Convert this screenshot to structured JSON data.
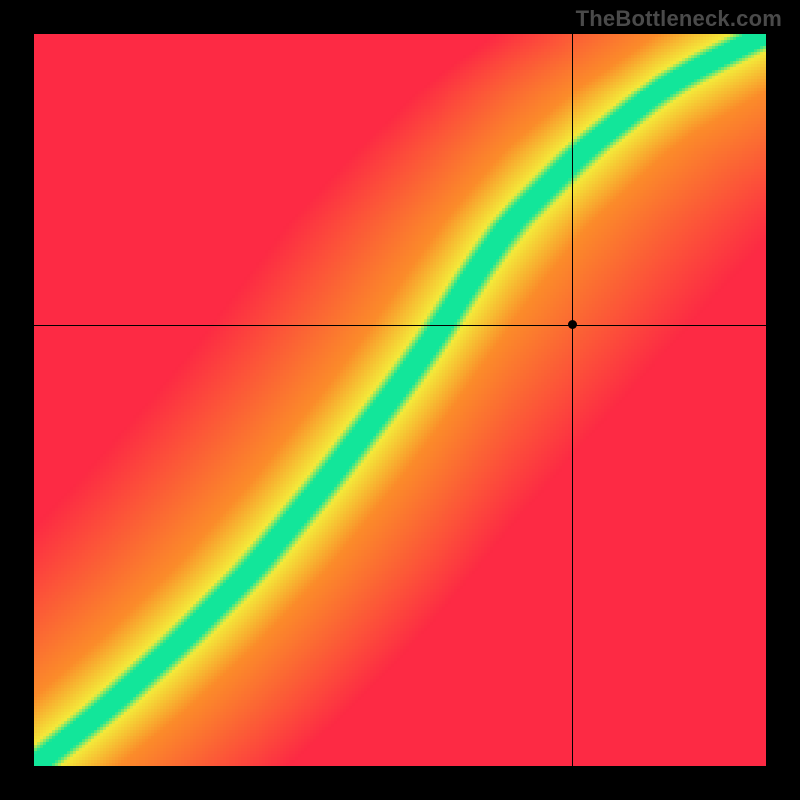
{
  "watermark": "TheBottleneck.com",
  "chart_data": {
    "type": "heatmap",
    "title": "",
    "xlabel": "",
    "ylabel": "",
    "xlim": [
      0,
      1
    ],
    "ylim": [
      0,
      1
    ],
    "crosshair": {
      "x": 0.735,
      "y": 0.603
    },
    "marker": {
      "x": 0.735,
      "y": 0.603
    },
    "ridge_path": [
      {
        "x": 0.0,
        "y": 0.0
      },
      {
        "x": 0.1,
        "y": 0.08
      },
      {
        "x": 0.2,
        "y": 0.17
      },
      {
        "x": 0.3,
        "y": 0.27
      },
      {
        "x": 0.4,
        "y": 0.39
      },
      {
        "x": 0.5,
        "y": 0.52
      },
      {
        "x": 0.55,
        "y": 0.59
      },
      {
        "x": 0.6,
        "y": 0.67
      },
      {
        "x": 0.65,
        "y": 0.74
      },
      {
        "x": 0.7,
        "y": 0.79
      },
      {
        "x": 0.75,
        "y": 0.84
      },
      {
        "x": 0.8,
        "y": 0.88
      },
      {
        "x": 0.85,
        "y": 0.92
      },
      {
        "x": 0.9,
        "y": 0.95
      },
      {
        "x": 0.95,
        "y": 0.975
      },
      {
        "x": 1.0,
        "y": 1.0
      }
    ],
    "ridge_width": 0.055,
    "gradient_colors": {
      "ridge": "#12e69a",
      "near": "#f4ea3a",
      "mid": "#fb8c2a",
      "far": "#fd2a44"
    },
    "horizontal_bias": 1.4
  }
}
